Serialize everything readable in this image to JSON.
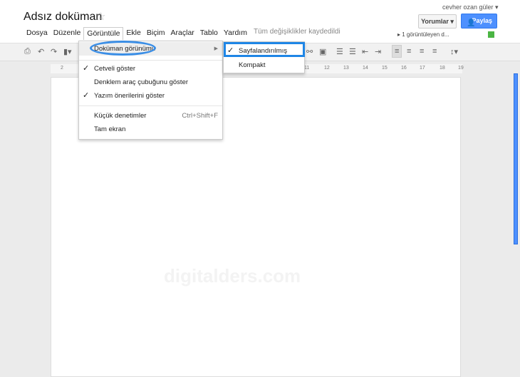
{
  "doc_title": "Adsız doküman",
  "user": "cevher ozan güler ▾",
  "menubar": [
    "Dosya",
    "Düzenle",
    "Görüntüle",
    "Ekle",
    "Biçim",
    "Araçlar",
    "Tablo",
    "Yardım"
  ],
  "save_status": "Tüm değişiklikler kaydedildi",
  "comments_label": "Yorumlar ▾",
  "share_label": "Paylaş",
  "viewers": "1 görüntüleyen d...",
  "ruler": [
    "2",
    "11",
    "12",
    "13",
    "14",
    "15",
    "16",
    "17",
    "18",
    "19"
  ],
  "view_menu": {
    "doc_view": "Doküman görünümü",
    "show_ruler": "Cetveli göster",
    "equation_toolbar": "Denklem araç çubuğunu göster",
    "spell_suggestions": "Yazım önerilerini göster",
    "compact_controls": "Küçük denetimler",
    "compact_shortcut": "Ctrl+Shift+F",
    "fullscreen": "Tam ekran"
  },
  "submenu": {
    "paginated": "Sayfalandırılmış",
    "compact": "Kompakt"
  },
  "watermark": "digitalders.com",
  "colors": {
    "accent": "#4d90fe",
    "highlight": "#1f86e6"
  }
}
